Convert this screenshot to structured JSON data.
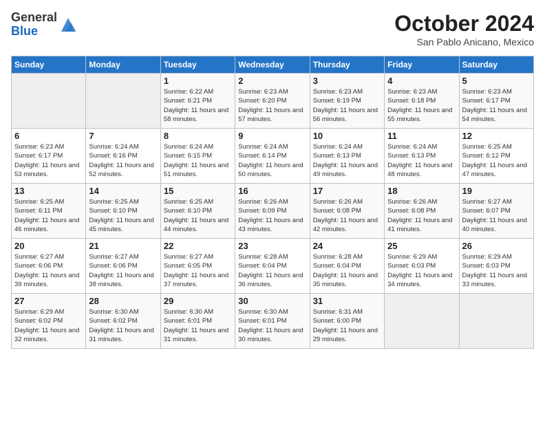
{
  "header": {
    "logo_general": "General",
    "logo_blue": "Blue",
    "month": "October 2024",
    "location": "San Pablo Anicano, Mexico"
  },
  "weekdays": [
    "Sunday",
    "Monday",
    "Tuesday",
    "Wednesday",
    "Thursday",
    "Friday",
    "Saturday"
  ],
  "weeks": [
    [
      {
        "day": "",
        "info": ""
      },
      {
        "day": "",
        "info": ""
      },
      {
        "day": "1",
        "info": "Sunrise: 6:22 AM\nSunset: 6:21 PM\nDaylight: 11 hours and 58 minutes."
      },
      {
        "day": "2",
        "info": "Sunrise: 6:23 AM\nSunset: 6:20 PM\nDaylight: 11 hours and 57 minutes."
      },
      {
        "day": "3",
        "info": "Sunrise: 6:23 AM\nSunset: 6:19 PM\nDaylight: 11 hours and 56 minutes."
      },
      {
        "day": "4",
        "info": "Sunrise: 6:23 AM\nSunset: 6:18 PM\nDaylight: 11 hours and 55 minutes."
      },
      {
        "day": "5",
        "info": "Sunrise: 6:23 AM\nSunset: 6:17 PM\nDaylight: 11 hours and 54 minutes."
      }
    ],
    [
      {
        "day": "6",
        "info": "Sunrise: 6:23 AM\nSunset: 6:17 PM\nDaylight: 11 hours and 53 minutes."
      },
      {
        "day": "7",
        "info": "Sunrise: 6:24 AM\nSunset: 6:16 PM\nDaylight: 11 hours and 52 minutes."
      },
      {
        "day": "8",
        "info": "Sunrise: 6:24 AM\nSunset: 6:15 PM\nDaylight: 11 hours and 51 minutes."
      },
      {
        "day": "9",
        "info": "Sunrise: 6:24 AM\nSunset: 6:14 PM\nDaylight: 11 hours and 50 minutes."
      },
      {
        "day": "10",
        "info": "Sunrise: 6:24 AM\nSunset: 6:13 PM\nDaylight: 11 hours and 49 minutes."
      },
      {
        "day": "11",
        "info": "Sunrise: 6:24 AM\nSunset: 6:13 PM\nDaylight: 11 hours and 48 minutes."
      },
      {
        "day": "12",
        "info": "Sunrise: 6:25 AM\nSunset: 6:12 PM\nDaylight: 11 hours and 47 minutes."
      }
    ],
    [
      {
        "day": "13",
        "info": "Sunrise: 6:25 AM\nSunset: 6:11 PM\nDaylight: 11 hours and 46 minutes."
      },
      {
        "day": "14",
        "info": "Sunrise: 6:25 AM\nSunset: 6:10 PM\nDaylight: 11 hours and 45 minutes."
      },
      {
        "day": "15",
        "info": "Sunrise: 6:25 AM\nSunset: 6:10 PM\nDaylight: 11 hours and 44 minutes."
      },
      {
        "day": "16",
        "info": "Sunrise: 6:26 AM\nSunset: 6:09 PM\nDaylight: 11 hours and 43 minutes."
      },
      {
        "day": "17",
        "info": "Sunrise: 6:26 AM\nSunset: 6:08 PM\nDaylight: 11 hours and 42 minutes."
      },
      {
        "day": "18",
        "info": "Sunrise: 6:26 AM\nSunset: 6:08 PM\nDaylight: 11 hours and 41 minutes."
      },
      {
        "day": "19",
        "info": "Sunrise: 6:27 AM\nSunset: 6:07 PM\nDaylight: 11 hours and 40 minutes."
      }
    ],
    [
      {
        "day": "20",
        "info": "Sunrise: 6:27 AM\nSunset: 6:06 PM\nDaylight: 11 hours and 39 minutes."
      },
      {
        "day": "21",
        "info": "Sunrise: 6:27 AM\nSunset: 6:06 PM\nDaylight: 11 hours and 38 minutes."
      },
      {
        "day": "22",
        "info": "Sunrise: 6:27 AM\nSunset: 6:05 PM\nDaylight: 11 hours and 37 minutes."
      },
      {
        "day": "23",
        "info": "Sunrise: 6:28 AM\nSunset: 6:04 PM\nDaylight: 11 hours and 36 minutes."
      },
      {
        "day": "24",
        "info": "Sunrise: 6:28 AM\nSunset: 6:04 PM\nDaylight: 11 hours and 35 minutes."
      },
      {
        "day": "25",
        "info": "Sunrise: 6:29 AM\nSunset: 6:03 PM\nDaylight: 11 hours and 34 minutes."
      },
      {
        "day": "26",
        "info": "Sunrise: 6:29 AM\nSunset: 6:03 PM\nDaylight: 11 hours and 33 minutes."
      }
    ],
    [
      {
        "day": "27",
        "info": "Sunrise: 6:29 AM\nSunset: 6:02 PM\nDaylight: 11 hours and 32 minutes."
      },
      {
        "day": "28",
        "info": "Sunrise: 6:30 AM\nSunset: 6:02 PM\nDaylight: 11 hours and 31 minutes."
      },
      {
        "day": "29",
        "info": "Sunrise: 6:30 AM\nSunset: 6:01 PM\nDaylight: 11 hours and 31 minutes."
      },
      {
        "day": "30",
        "info": "Sunrise: 6:30 AM\nSunset: 6:01 PM\nDaylight: 11 hours and 30 minutes."
      },
      {
        "day": "31",
        "info": "Sunrise: 6:31 AM\nSunset: 6:00 PM\nDaylight: 11 hours and 29 minutes."
      },
      {
        "day": "",
        "info": ""
      },
      {
        "day": "",
        "info": ""
      }
    ]
  ]
}
